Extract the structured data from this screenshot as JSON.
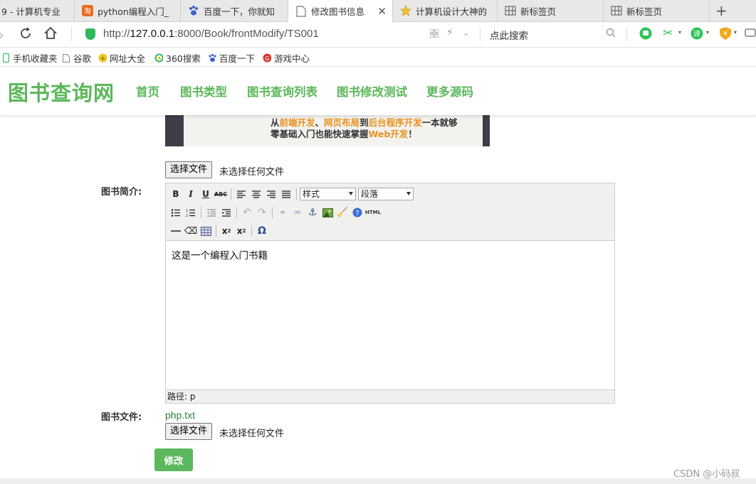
{
  "browser": {
    "tabs": [
      {
        "title": "9 - 计算机专业"
      },
      {
        "title": "python编程入门_"
      },
      {
        "title": "百度一下，你就知"
      },
      {
        "title": "修改图书信息"
      },
      {
        "title": "计算机设计大神的"
      },
      {
        "title": "新标签页"
      },
      {
        "title": "新标签页"
      }
    ],
    "url_prefix": "http://",
    "url_host": "127.0.0.1",
    "url_path": ":8000/Book/frontModify/TS001",
    "search_placeholder": "点此搜索",
    "bookmarks": [
      "手机收藏夹",
      "谷歌",
      "网址大全",
      "360搜索",
      "百度一下",
      "游戏中心"
    ]
  },
  "site": {
    "logo": "图书查询网",
    "nav": [
      "首页",
      "图书类型",
      "图书查询列表",
      "图书修改测试",
      "更多源码"
    ]
  },
  "cover": {
    "line1_a": "从",
    "line1_b": "前端开发",
    "line1_c": "、",
    "line1_d": "网页布局",
    "line1_e": "到",
    "line1_f": "后台程序开发",
    "line1_g": "一本就够",
    "line2_a": "零基础入门也能快速掌握",
    "line2_b": "Web开发",
    "line2_c": "！"
  },
  "form": {
    "file_button": "选择文件",
    "file_status": "未选择任何文件",
    "intro_label": "图书简介:",
    "editor": {
      "style_select": "样式",
      "format_select": "段落",
      "content": "这是一个编程入门书籍",
      "status": "路径: p"
    },
    "file_label": "图书文件:",
    "current_file": "php.txt",
    "submit_label": "修改"
  },
  "watermark": "CSDN @小码叔"
}
